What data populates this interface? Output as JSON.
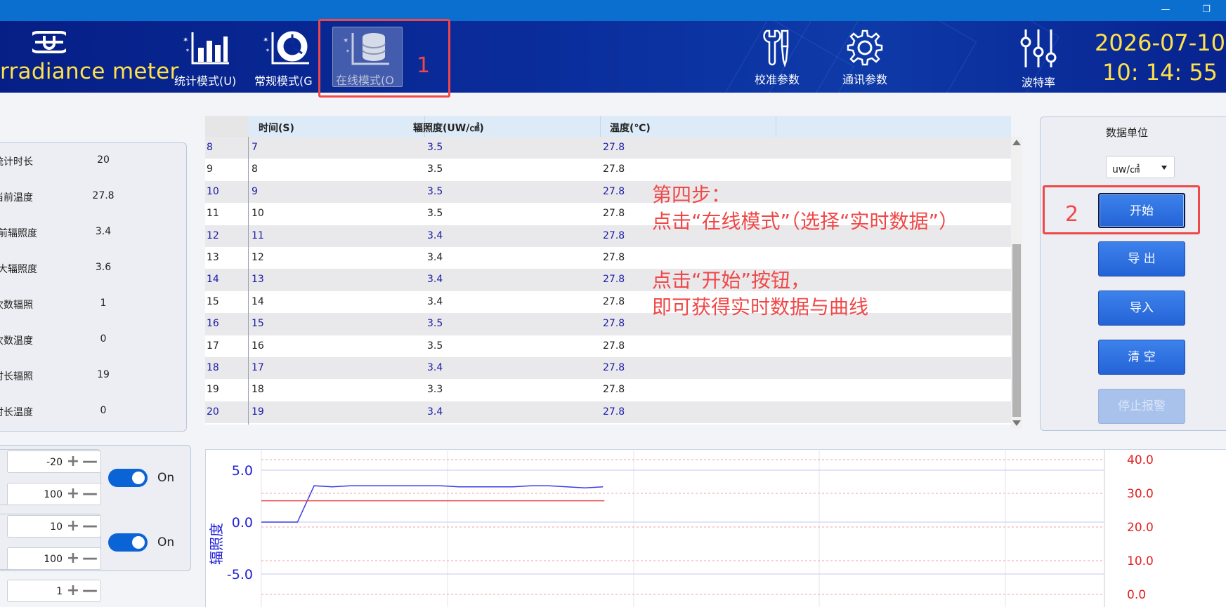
{
  "window": {
    "minimize_glyph": "—",
    "restore_glyph": "❐"
  },
  "header": {
    "app_title": "rradiance meter",
    "modes": [
      {
        "label": "统计模式(U)",
        "icon": "bar-chart-icon"
      },
      {
        "label": "常规模式(G",
        "icon": "donut-chart-icon"
      },
      {
        "label": "在线模式(O",
        "icon": "database-icon"
      }
    ],
    "tools": [
      {
        "label": "校准参数",
        "icon": "wrench-screwdriver-icon"
      },
      {
        "label": "通讯参数",
        "icon": "gear-icon"
      },
      {
        "label": "波特率",
        "icon": "sliders-icon"
      }
    ],
    "date": "2026-07-10",
    "time": "10: 14: 55"
  },
  "annotations": {
    "box1_number": "1",
    "box2_number": "2",
    "step_text": [
      "第四步：",
      "点击“在线模式”（选择“实时数据”）",
      "",
      "点击“开始”按钮，",
      "即可获得实时数据与曲线"
    ]
  },
  "stats": [
    {
      "label": "统计时长",
      "value": "20"
    },
    {
      "label": "当前温度",
      "value": "27.8"
    },
    {
      "label": "当前辐照度",
      "value": "3.4"
    },
    {
      "label": "最大辐照度",
      "value": "3.6"
    },
    {
      "label": "次数辐照",
      "value": "1"
    },
    {
      "label": "次数温度",
      "value": "0"
    },
    {
      "label": "时长辐照",
      "value": "19"
    },
    {
      "label": "时长温度",
      "value": "0"
    }
  ],
  "controls": {
    "group1": {
      "input_a": "-20",
      "input_b": "100",
      "toggle_label": "On"
    },
    "group2": {
      "input_a": "10",
      "input_b": "100",
      "toggle_label": "On"
    },
    "group3": {
      "input_a": "1"
    },
    "plus_glyph": "+",
    "minus_glyph": "—"
  },
  "table": {
    "headers": [
      "时间(S)",
      "辐照度(UW/㎠)",
      "温度(℃)"
    ],
    "rows": [
      {
        "idx": "8",
        "time": "7",
        "irr": "3.5",
        "temp": "27.8"
      },
      {
        "idx": "9",
        "time": "8",
        "irr": "3.5",
        "temp": "27.8"
      },
      {
        "idx": "10",
        "time": "9",
        "irr": "3.5",
        "temp": "27.8"
      },
      {
        "idx": "11",
        "time": "10",
        "irr": "3.5",
        "temp": "27.8"
      },
      {
        "idx": "12",
        "time": "11",
        "irr": "3.4",
        "temp": "27.8"
      },
      {
        "idx": "13",
        "time": "12",
        "irr": "3.4",
        "temp": "27.8"
      },
      {
        "idx": "14",
        "time": "13",
        "irr": "3.4",
        "temp": "27.8"
      },
      {
        "idx": "15",
        "time": "14",
        "irr": "3.4",
        "temp": "27.8"
      },
      {
        "idx": "16",
        "time": "15",
        "irr": "3.5",
        "temp": "27.8"
      },
      {
        "idx": "17",
        "time": "16",
        "irr": "3.5",
        "temp": "27.8"
      },
      {
        "idx": "18",
        "time": "17",
        "irr": "3.4",
        "temp": "27.8"
      },
      {
        "idx": "19",
        "time": "18",
        "irr": "3.3",
        "temp": "27.8"
      },
      {
        "idx": "20",
        "time": "19",
        "irr": "3.4",
        "temp": "27.8"
      }
    ]
  },
  "right_panel": {
    "unit_title": "数据单位",
    "unit_value": "uw/㎠",
    "buttons": {
      "start": "开始",
      "export": "导  出",
      "import": "导入",
      "clear": "清  空",
      "stop_alarm": "停止报警"
    }
  },
  "chart_data": {
    "type": "line",
    "ylabel": "辐照度",
    "y_left_ticks": [
      "5.0",
      "0.0",
      "-5.0"
    ],
    "y_right_ticks": [
      "40.0",
      "30.0",
      "20.0",
      "10.0",
      "0.0"
    ],
    "ylim_left": [
      -7,
      7
    ],
    "ylim_right": [
      0,
      40
    ],
    "grid": true,
    "series": [
      {
        "axis": "left",
        "color": "#3a3ae8",
        "x": [
          0,
          1,
          2,
          3,
          4,
          5,
          6,
          7,
          8,
          9,
          10,
          11,
          12,
          13,
          14,
          15,
          16,
          17,
          18,
          19
        ],
        "y": [
          0,
          0,
          0,
          3.5,
          3.4,
          3.5,
          3.5,
          3.5,
          3.5,
          3.5,
          3.5,
          3.4,
          3.4,
          3.4,
          3.4,
          3.5,
          3.5,
          3.4,
          3.3,
          3.4
        ]
      },
      {
        "axis": "right",
        "color": "#e84848",
        "x": [
          0,
          19
        ],
        "y": [
          27.8,
          27.8
        ]
      }
    ],
    "colors": {
      "irradiance": "#3a3ae8",
      "temperature": "#e84848"
    }
  }
}
